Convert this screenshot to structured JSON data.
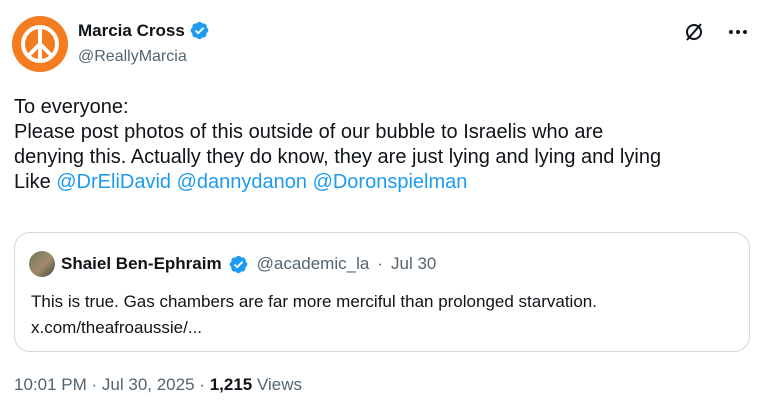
{
  "author": {
    "display_name": "Marcia Cross",
    "handle": "@ReallyMarcia",
    "avatar_icon": "peace-sign-icon",
    "avatar_color": "#f47c20",
    "verified_color": "#1d9bf0"
  },
  "actions": {
    "grok_icon": "grok-icon",
    "more_icon": "more-options-icon"
  },
  "tweet": {
    "line1": "To everyone:",
    "line2": "Please post photos of this outside of our bubble to Israelis who are",
    "line3": "denying this. Actually they do know, they are just lying and lying and lying",
    "line4_prefix": "Like ",
    "mentions": [
      "@DrEliDavid",
      "@dannydanon",
      "@Doronspielman"
    ]
  },
  "quote": {
    "display_name": "Shaiel Ben-Ephraim",
    "handle": "@academic_la",
    "separator": "·",
    "date": "Jul 30",
    "line1": "This is true. Gas chambers are far more merciful than prolonged starvation.",
    "line2": "x.com/theafroaussie/..."
  },
  "footer": {
    "time": "10:01 PM",
    "separator": "·",
    "date": "Jul 30, 2025",
    "separator2": "·",
    "views_count": "1,215",
    "views_label": "Views"
  }
}
